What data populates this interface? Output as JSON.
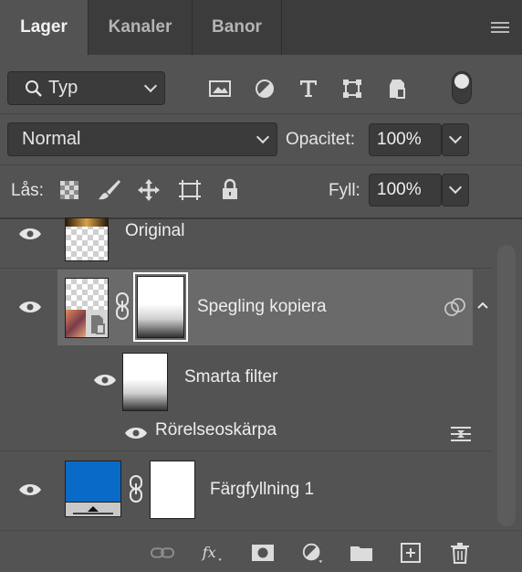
{
  "tabs": [
    {
      "label": "Lager",
      "active": true
    },
    {
      "label": "Kanaler",
      "active": false
    },
    {
      "label": "Banor",
      "active": false
    }
  ],
  "filter": {
    "kind_label": "Typ",
    "icons": [
      "image-filter-icon",
      "adjustment-filter-icon",
      "type-filter-icon",
      "shape-filter-icon",
      "smart-object-filter-icon"
    ]
  },
  "blend": {
    "mode": "Normal",
    "opacity_label": "Opacitet:",
    "opacity_value": "100%"
  },
  "lock": {
    "label": "Lås:",
    "fill_label": "Fyll:",
    "fill_value": "100%"
  },
  "layers": [
    {
      "name": "Original",
      "visible": true
    },
    {
      "name": "Spegling kopiera",
      "visible": true,
      "selected": true
    },
    {
      "name": "Smarta filter",
      "visible": true,
      "sub": true
    },
    {
      "name": "Rörelseoskärpa",
      "visible": true,
      "filter": true
    },
    {
      "name": "Färgfyllning 1",
      "visible": true,
      "fill_color": "#0a6ac8"
    }
  ],
  "colors": {
    "panel_bg": "#535353",
    "selected_row": "#6a6a6a",
    "fill_blue": "#0a6ac8"
  }
}
